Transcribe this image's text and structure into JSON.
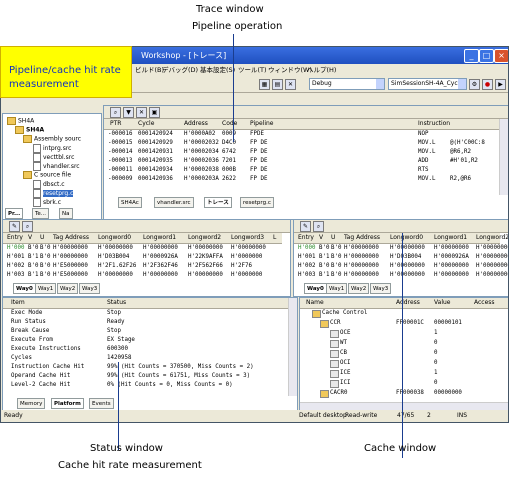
{
  "callouts": {
    "trace_window": "Trace window",
    "pipeline_operation": "Pipeline operation",
    "status_window": "Status window",
    "cache_hit_rate": "Cache hit rate measurement",
    "cache_window": "Cache window",
    "banner": [
      "Pipeline/cache hit rate",
      "measurement"
    ]
  },
  "window": {
    "title": "Workshop - [トレース]",
    "menu": [
      "ビルド(B)",
      "デバッグ(D)",
      "基本設定(S)",
      "ツール(T)",
      "ウィンドウ(W)",
      "ヘルプ(H)"
    ],
    "combo_config": "Debug",
    "combo_session": "SimSessionSH-4A_Cycle"
  },
  "tree": {
    "items": [
      {
        "label": "SH4A",
        "type": "root"
      },
      {
        "label": "SH4A",
        "type": "project"
      },
      {
        "label": "Assembly sourc",
        "type": "folder"
      },
      {
        "label": "intprg.src",
        "type": "file"
      },
      {
        "label": "vecttbl.src",
        "type": "file"
      },
      {
        "label": "vhandler.src",
        "type": "file"
      },
      {
        "label": "C source file",
        "type": "folder"
      },
      {
        "label": "dbsct.c",
        "type": "file"
      },
      {
        "label": "resetprg.c",
        "type": "file",
        "selected": true
      },
      {
        "label": "sbrk.c",
        "type": "file"
      }
    ],
    "tabs": [
      "Pr...",
      "Te...",
      "Na"
    ]
  },
  "trace": {
    "headers": [
      "PTR",
      "Cycle",
      "Address",
      "Code",
      "Pipeline",
      "Instruction"
    ],
    "rows": [
      [
        "-000016",
        "0001420924",
        "H'0000A02",
        "0009",
        "FPDE",
        "",
        "NOP",
        ""
      ],
      [
        "-000015",
        "0001420929",
        "H'00002032",
        "D4C0",
        "FP  DE",
        "",
        "MOV.L",
        "@(H'C00C:8"
      ],
      [
        "-000014",
        "0001420931",
        "H'00002034",
        "6742",
        "FP      DE",
        "",
        "MOV.L",
        "@R6,R2"
      ],
      [
        "-000013",
        "0001420935",
        "H'00002036",
        "7201",
        "FP              DE",
        "",
        "ADD",
        "#H'01,R2"
      ],
      [
        "-000011",
        "0001420934",
        "H'00002038",
        "000B",
        "        FP  DE",
        "",
        "RTS",
        ""
      ],
      [
        "-000009",
        "0001420936",
        "H'0000203A",
        "2622",
        "        FP  DE",
        "",
        "MOV.L",
        "R2,@R6"
      ]
    ],
    "tabs": [
      "SH4Ac",
      "vhandler.src",
      "トレース",
      "resetprg.c"
    ]
  },
  "cache_left": {
    "headers": [
      "Entry",
      "V",
      "U",
      "Tag Address",
      "Longword0",
      "Longword1",
      "Longword2",
      "Longword3",
      "L"
    ],
    "rows": [
      [
        "H'000",
        "B'0",
        "B'0",
        "H'00000000",
        "H'00000000",
        "H'00000000",
        "H'00000000",
        "H'00000000"
      ],
      [
        "H'001",
        "B'1",
        "B'0",
        "H'00000000",
        "H'D03B004",
        "H'0000926A",
        "H'22K9AFFA",
        "H'0000000"
      ],
      [
        "H'002",
        "B'0",
        "B'0",
        "H'E5000000",
        "H'2F1.62F26",
        "H'2F362F46",
        "H'2F562F66",
        "H'2F76"
      ],
      [
        "H'003",
        "B'1",
        "B'0",
        "H'E5000000",
        "H'00000000",
        "H'00000000",
        "H'00000000",
        "H'0000000"
      ]
    ],
    "tabs": [
      "Way0",
      "Way1",
      "Way2",
      "Way3"
    ]
  },
  "cache_right": {
    "headers": [
      "Entry",
      "V",
      "U",
      "Tag Address",
      "Longword0",
      "Longword1",
      "Longword2"
    ],
    "rows": [
      [
        "H'000",
        "B'0",
        "B'0",
        "H'00000000",
        "H'00000000",
        "H'00000000",
        "H'00000000"
      ],
      [
        "H'001",
        "B'1",
        "B'0",
        "H'00000000",
        "H'D03B004",
        "H'0000926A",
        "H'00000000"
      ],
      [
        "H'002",
        "B'0",
        "B'0",
        "H'00000000",
        "H'00000000",
        "H'00000000",
        "H'00000000"
      ],
      [
        "H'003",
        "B'1",
        "B'0",
        "H'00000000",
        "H'00000000",
        "H'00000000",
        "H'00000000"
      ]
    ],
    "tabs": [
      "Way0",
      "Way1",
      "Way2",
      "Way3"
    ]
  },
  "status_window": {
    "headers": [
      "Item",
      "Status"
    ],
    "rows": [
      [
        "Exec Mode",
        "Stop"
      ],
      [
        "Run Status",
        "Ready"
      ],
      [
        "Break Cause",
        "Stop"
      ],
      [
        "Execute From",
        "EX Stage"
      ],
      [
        "Execute Instructions",
        "600300"
      ],
      [
        "Cycles",
        "1420958"
      ],
      [
        "Instruction Cache Hit",
        "99% (Hit Counts = 370500, Miss Counts = 2)"
      ],
      [
        "Operand Cache Hit",
        "99% (Hit Counts = 61751, Miss Counts = 3)"
      ],
      [
        "Level-2 Cache Hit",
        "0% (Hit Counts = 0, Miss Counts = 0)"
      ]
    ],
    "tabs": [
      "Memory",
      "Platform",
      "Events"
    ]
  },
  "cache_tree": {
    "headers": [
      "Name",
      "Address",
      "Value",
      "Access"
    ],
    "rows": [
      [
        "Cache Control",
        "",
        "",
        ""
      ],
      [
        "CCR",
        "FF00001C",
        "00000101",
        ""
      ],
      [
        "OCE",
        "",
        "1",
        ""
      ],
      [
        "WT",
        "",
        "0",
        ""
      ],
      [
        "CB",
        "",
        "0",
        ""
      ],
      [
        "OCI",
        "",
        "0",
        ""
      ],
      [
        "ICE",
        "",
        "1",
        ""
      ],
      [
        "ICI",
        "",
        "0",
        ""
      ],
      [
        "CACR0",
        "FF000038",
        "00000000",
        ""
      ]
    ]
  },
  "statusbar": {
    "ready": "Ready",
    "desktop": "Default desktop",
    "mode": "Read-write",
    "pos": "47/65",
    "col": "2",
    "ins": "INS"
  }
}
